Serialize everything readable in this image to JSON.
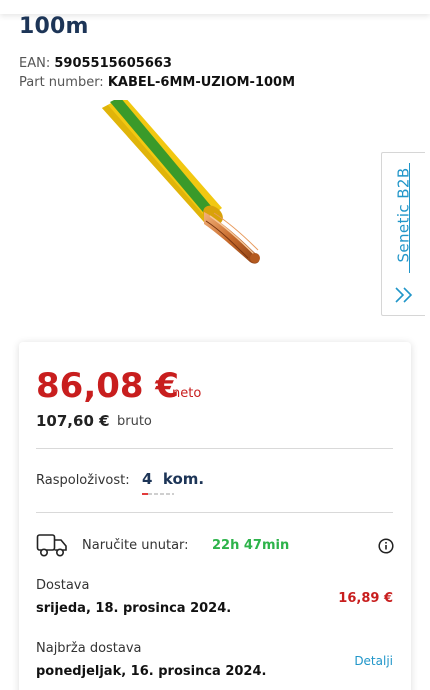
{
  "product": {
    "title": "100m",
    "ean_label": "EAN:",
    "ean_value": "5905515605663",
    "partno_label": "Part number:",
    "partno_value": "KABEL-6MM-UZIOM-100M",
    "image_icon": "cable-product-image"
  },
  "b2b_tab": {
    "label": "Senetic B2B",
    "chevron_icon": "double-chevron-right-icon"
  },
  "pricing": {
    "net_price": "86,08 €",
    "net_label": "neto",
    "gross_price": "107,60 €",
    "gross_label": "bruto"
  },
  "availability": {
    "label": "Raspoloživost:",
    "value": "4  kom."
  },
  "order": {
    "truck_icon": "truck-icon",
    "label": "Naručite unutar:",
    "time": "22h 47min",
    "info_icon": "info-icon"
  },
  "delivery": {
    "label": "Dostava",
    "date": "srijeda, 18. prosinca 2024.",
    "price": "16,89 €"
  },
  "fastest_delivery": {
    "label": "Najbrža dostava",
    "date": "ponedjeljak, 16. prosinca 2024.",
    "details_link": "Detalji"
  },
  "colors": {
    "brand_blue": "#2196c9",
    "price_red": "#c81e1e",
    "timer_green": "#2db34a",
    "title_navy": "#1d3557"
  }
}
